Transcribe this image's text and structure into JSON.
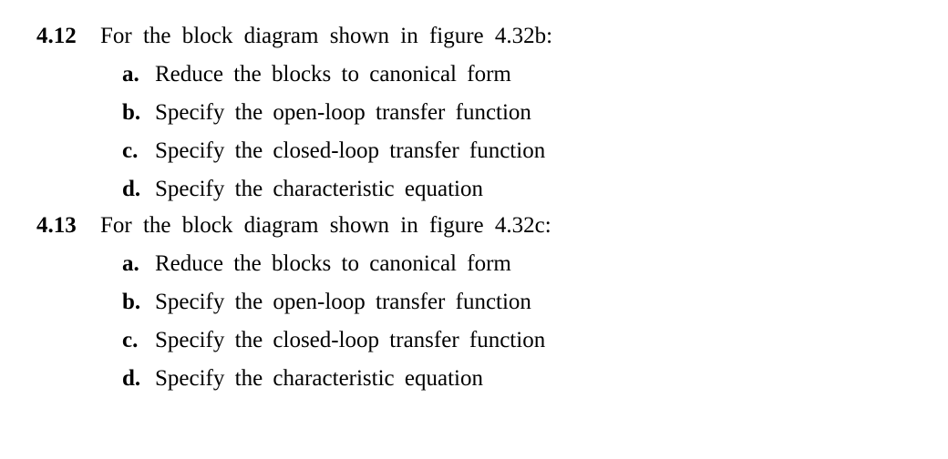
{
  "problems": [
    {
      "number": "4.12",
      "stem": "For the block diagram shown in figure 4.32b:",
      "items": [
        {
          "label": "a.",
          "text": "Reduce the blocks to canonical form"
        },
        {
          "label": "b.",
          "text": "Specify the open-loop transfer function"
        },
        {
          "label": "c.",
          "text": "Specify the closed-loop transfer function"
        },
        {
          "label": "d.",
          "text": "Specify the characteristic equation"
        }
      ]
    },
    {
      "number": "4.13",
      "stem": "For the block diagram shown in figure 4.32c:",
      "items": [
        {
          "label": "a.",
          "text": "Reduce the blocks to canonical form"
        },
        {
          "label": "b.",
          "text": "Specify the open-loop transfer function"
        },
        {
          "label": "c.",
          "text": "Specify the closed-loop transfer function"
        },
        {
          "label": "d.",
          "text": "Specify the characteristic equation"
        }
      ]
    }
  ]
}
